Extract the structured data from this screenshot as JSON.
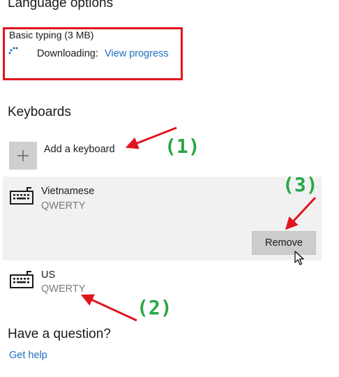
{
  "language_options": {
    "title": "Language options",
    "feature": {
      "name": "Basic typing (3 MB)",
      "status_label": "Downloading:",
      "progress_link": "View progress"
    }
  },
  "keyboards": {
    "title": "Keyboards",
    "add_label": "Add a keyboard",
    "items": [
      {
        "name": "Vietnamese",
        "layout": "QWERTY",
        "selected": true
      },
      {
        "name": "US",
        "layout": "QWERTY",
        "selected": false
      }
    ],
    "remove_label": "Remove"
  },
  "help": {
    "title": "Have a question?",
    "link": "Get help"
  },
  "annotations": {
    "step1": "(1)",
    "step2": "(2)",
    "step3": "(3)"
  },
  "colors": {
    "accent_link": "#1b6fc0",
    "highlight_box": "#e0141e",
    "arrow": "#e0141e",
    "annotation": "#28a745",
    "selected_row": "#f1f1f1",
    "remove_button": "#cccccc"
  },
  "icons": {
    "add": "plus-icon",
    "keyboard": "keyboard-icon",
    "progress": "spinner-icon",
    "cursor": "mouse-pointer-icon"
  }
}
